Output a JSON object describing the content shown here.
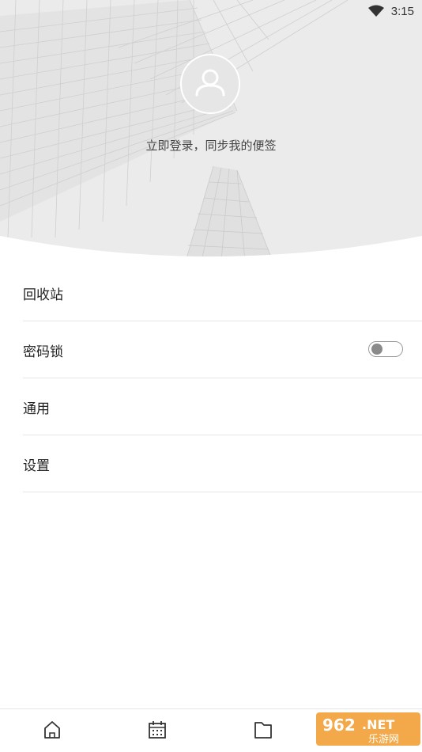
{
  "status_bar": {
    "time": "3:15",
    "wifi_icon": "wifi-icon"
  },
  "profile": {
    "avatar_icon": "user-avatar-icon",
    "login_prompt": "立即登录，同步我的便签"
  },
  "menu": {
    "items": [
      {
        "label": "回收站"
      },
      {
        "label": "密码锁",
        "toggle_on": false
      },
      {
        "label": "通用"
      },
      {
        "label": "设置"
      }
    ]
  },
  "bottom_nav": {
    "items": [
      {
        "icon": "home-icon"
      },
      {
        "icon": "calendar-icon"
      },
      {
        "icon": "folder-icon"
      }
    ]
  },
  "watermark": {
    "brand": "962.NET",
    "subtext": "乐游网"
  }
}
